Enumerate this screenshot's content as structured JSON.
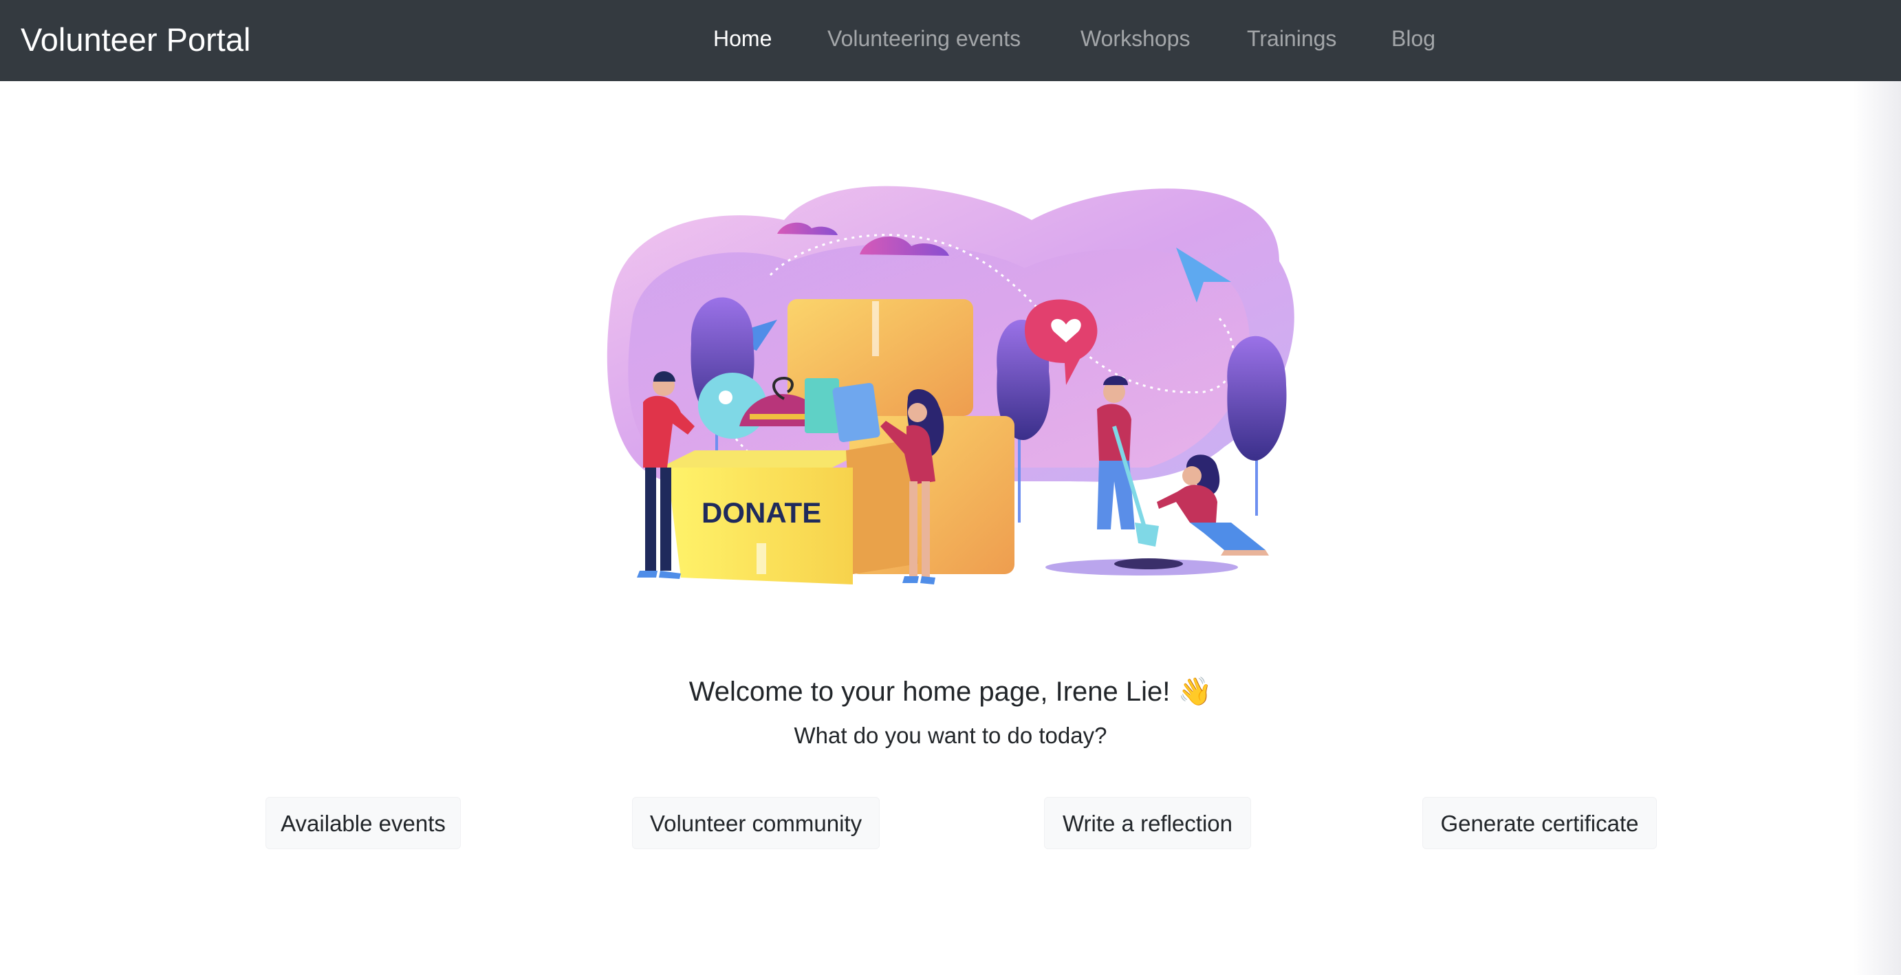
{
  "navbar": {
    "brand": "Volunteer Portal",
    "links": [
      {
        "label": "Home",
        "active": true
      },
      {
        "label": "Volunteering events",
        "active": false
      },
      {
        "label": "Workshops",
        "active": false
      },
      {
        "label": "Trainings",
        "active": false
      },
      {
        "label": "Blog",
        "active": false
      }
    ],
    "background_color": "#343a40"
  },
  "hero": {
    "illustration_text": "DONATE"
  },
  "welcome": {
    "heading": "Welcome to your home page, Irene Lie!",
    "emoji": "👋",
    "subtitle": "What do you want to do today?"
  },
  "actions": [
    {
      "label": "Available events"
    },
    {
      "label": "Volunteer community"
    },
    {
      "label": "Write a reflection"
    },
    {
      "label": "Generate certificate"
    }
  ]
}
